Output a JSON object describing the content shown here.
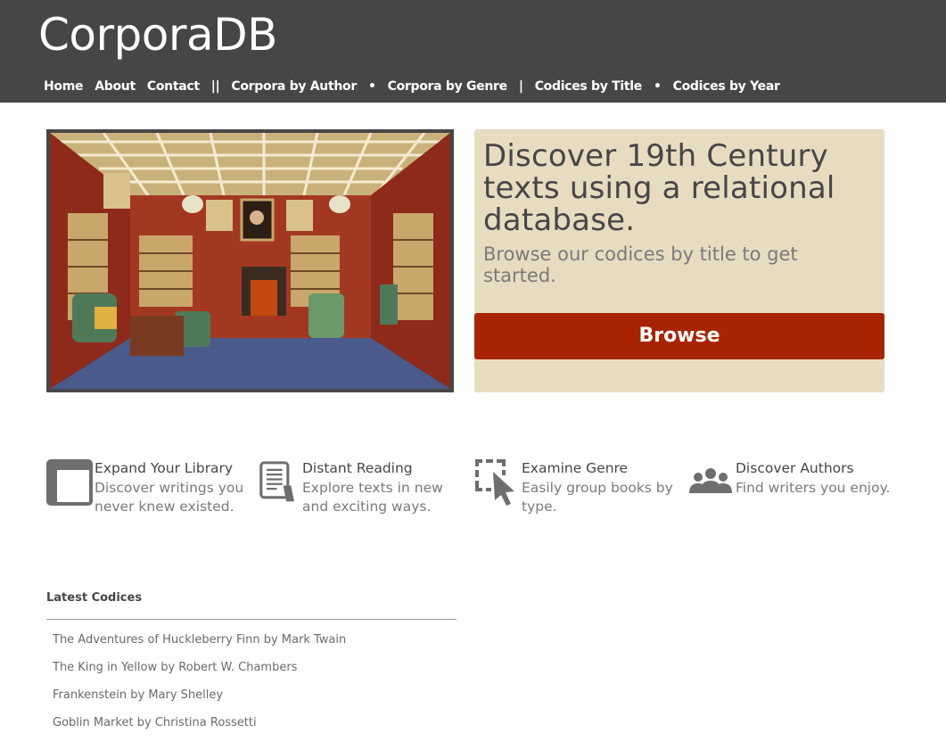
{
  "header": {
    "brand": "CorporaDB",
    "nav": [
      {
        "label": "Home"
      },
      {
        "label": "About"
      },
      {
        "label": "Contact"
      },
      {
        "label": "||",
        "separator": true
      },
      {
        "label": "Corpora by Author"
      },
      {
        "label": "•",
        "separator": true
      },
      {
        "label": "Corpora by Genre"
      },
      {
        "label": "|",
        "separator": true
      },
      {
        "label": "Codices by Title"
      },
      {
        "label": "•",
        "separator": true
      },
      {
        "label": "Codices by Year"
      }
    ]
  },
  "hero": {
    "image_icon": "library-room-painting",
    "title": "Discover 19th Century texts using a relational database.",
    "subtitle": "Browse our codices by title to get started.",
    "button_label": "Browse"
  },
  "features": [
    {
      "icon": "book-icon",
      "title": "Expand Your Library",
      "desc": "Discover writings you never knew existed."
    },
    {
      "icon": "tablet-reading-icon",
      "title": "Distant Reading",
      "desc": "Explore texts in new and exciting ways."
    },
    {
      "icon": "selection-cursor-icon",
      "title": "Examine Genre",
      "desc": "Easily group books by type."
    },
    {
      "icon": "people-group-icon",
      "title": "Discover Authors",
      "desc": "Find writers you enjoy."
    }
  ],
  "latest": {
    "title": "Latest Codices",
    "items": [
      "The Adventures of Huckleberry Finn by Mark Twain",
      "The King in Yellow by Robert W. Chambers",
      "Frankenstein by Mary Shelley",
      "Goblin Market by Christina Rossetti"
    ]
  },
  "colors": {
    "header_bg": "#464646",
    "panel_bg": "#e8dcc0",
    "button_bg": "#a82400",
    "text_dark": "#464646",
    "text_gray": "#7a7a7a"
  }
}
